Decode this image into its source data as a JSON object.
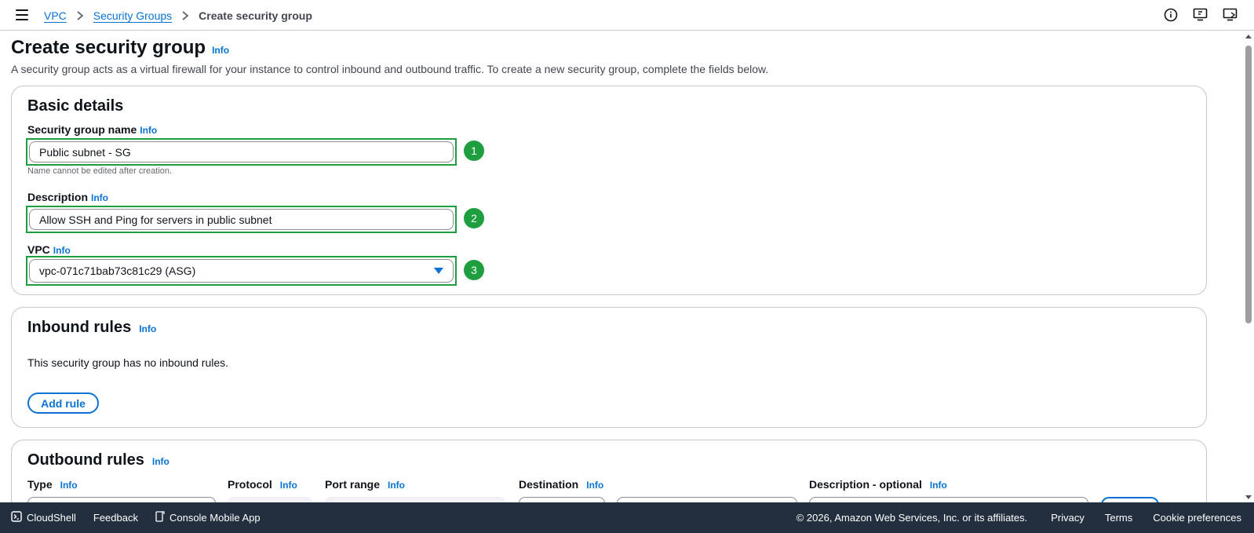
{
  "breadcrumb": {
    "items": [
      {
        "label": "VPC"
      },
      {
        "label": "Security Groups"
      },
      {
        "label": "Create security group"
      }
    ]
  },
  "header_icons": [
    "info-circle-icon",
    "feedback-screen-icon",
    "screen-share-icon"
  ],
  "page": {
    "title": "Create security group",
    "title_info": "Info",
    "description": "A security group acts as a virtual firewall for your instance to control inbound and outbound traffic. To create a new security group, complete the fields below."
  },
  "basic_details": {
    "title": "Basic details",
    "name_label": "Security group name",
    "name_info": "Info",
    "name_value": "Public subnet - SG",
    "name_badge": "1",
    "name_hint": "Name cannot be edited after creation.",
    "desc_label": "Description",
    "desc_info": "Info",
    "desc_value": "Allow SSH and Ping for servers in public subnet",
    "desc_badge": "2",
    "vpc_label": "VPC",
    "vpc_info": "Info",
    "vpc_value": "vpc-071c71bab73c81c29 (ASG)",
    "vpc_badge": "3"
  },
  "inbound": {
    "title": "Inbound rules",
    "info": "Info",
    "empty_text": "This security group has no inbound rules.",
    "add_rule": "Add rule"
  },
  "outbound": {
    "title": "Outbound rules",
    "info": "Info",
    "columns": [
      {
        "label": "Type",
        "info": "Info"
      },
      {
        "label": "Protocol",
        "info": "Info"
      },
      {
        "label": "Port range",
        "info": "Info"
      },
      {
        "label": "Destination",
        "info": "Info"
      },
      {
        "label": "Description - optional",
        "info": "Info"
      }
    ]
  },
  "footer": {
    "cloudshell": "CloudShell",
    "feedback": "Feedback",
    "mobile_app": "Console Mobile App",
    "copyright": "© 2026, Amazon Web Services, Inc. or its affiliates.",
    "privacy": "Privacy",
    "terms": "Terms",
    "cookies": "Cookie preferences"
  },
  "colors": {
    "link": "#0972d3",
    "highlight": "#1e9e3e",
    "footer_bg": "#232f3e"
  }
}
